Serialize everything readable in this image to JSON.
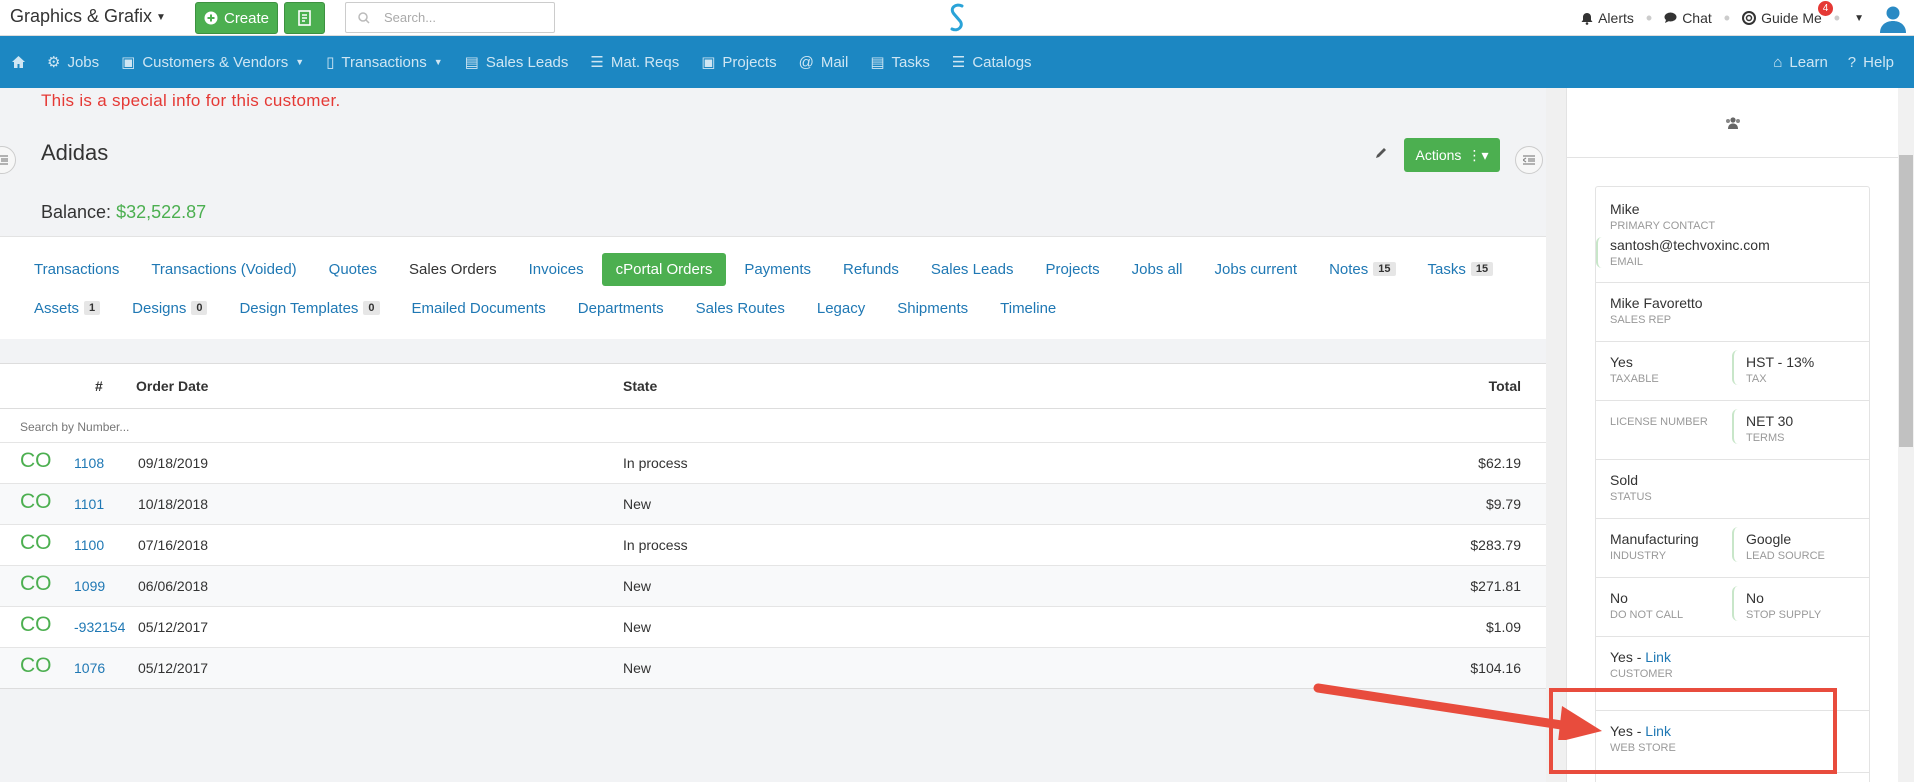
{
  "topbar": {
    "brand": "Graphics & Grafix",
    "create_label": "Create",
    "search_placeholder": "Search...",
    "alerts": "Alerts",
    "chat": "Chat",
    "guide": "Guide Me",
    "guide_badge": "4"
  },
  "nav": {
    "items": [
      "Jobs",
      "Customers & Vendors",
      "Transactions",
      "Sales Leads",
      "Mat. Reqs",
      "Projects",
      "Mail",
      "Tasks",
      "Catalogs"
    ],
    "learn": "Learn",
    "help": "Help"
  },
  "customer": {
    "special_info": "This is a special info for this customer.",
    "name": "Adidas",
    "balance_label": "Balance:",
    "balance_value": "$32,522.87",
    "actions_label": "Actions"
  },
  "tabs": {
    "row1": [
      {
        "label": "Transactions"
      },
      {
        "label": "Transactions (Voided)"
      },
      {
        "label": "Quotes"
      },
      {
        "label": "Sales Orders"
      },
      {
        "label": "Invoices"
      },
      {
        "label": "cPortal Orders"
      },
      {
        "label": "Payments"
      },
      {
        "label": "Refunds"
      },
      {
        "label": "Sales Leads"
      },
      {
        "label": "Projects"
      },
      {
        "label": "Jobs all"
      },
      {
        "label": "Jobs current"
      },
      {
        "label": "Notes",
        "count": "15"
      },
      {
        "label": "Tasks",
        "count": "15"
      }
    ],
    "row2": [
      {
        "label": "Assets",
        "count": "1"
      },
      {
        "label": "Designs",
        "count": "0"
      },
      {
        "label": "Design Templates",
        "count": "0"
      },
      {
        "label": "Emailed Documents"
      },
      {
        "label": "Departments"
      },
      {
        "label": "Sales Routes"
      },
      {
        "label": "Legacy"
      },
      {
        "label": "Shipments"
      },
      {
        "label": "Timeline"
      }
    ]
  },
  "orders": {
    "headers": {
      "num": "#",
      "date": "Order Date",
      "state": "State",
      "total": "Total"
    },
    "search_placeholder": "Search by Number...",
    "rows": [
      {
        "badge": "CO",
        "num": "1108",
        "date": "09/18/2019",
        "state": "In process",
        "total": "$62.19"
      },
      {
        "badge": "CO",
        "num": "1101",
        "date": "10/18/2018",
        "state": "New",
        "total": "$9.79"
      },
      {
        "badge": "CO",
        "num": "1100",
        "date": "07/16/2018",
        "state": "In process",
        "total": "$283.79"
      },
      {
        "badge": "CO",
        "num": "1099",
        "date": "06/06/2018",
        "state": "New",
        "total": "$271.81"
      },
      {
        "badge": "CO",
        "num": "-932154",
        "date": "05/12/2017",
        "state": "New",
        "total": "$1.09"
      },
      {
        "badge": "CO",
        "num": "1076",
        "date": "05/12/2017",
        "state": "New",
        "total": "$104.16"
      }
    ]
  },
  "panel": {
    "contact_name": "Mike",
    "contact_label": "PRIMARY CONTACT",
    "email": "santosh@techvoxinc.com",
    "email_label": "EMAIL",
    "rep": "Mike Favoretto",
    "rep_label": "SALES REP",
    "taxable": "Yes",
    "taxable_label": "TAXABLE",
    "tax": "HST - 13%",
    "tax_label": "TAX",
    "license_label": "LICENSE NUMBER",
    "terms": "NET 30",
    "terms_label": "TERMS",
    "status": "Sold",
    "status_label": "STATUS",
    "industry": "Manufacturing",
    "industry_label": "INDUSTRY",
    "lead_source": "Google",
    "lead_source_label": "LEAD SOURCE",
    "dnc": "No",
    "dnc_label": "DO NOT CALL",
    "stop_supply": "No",
    "stop_supply_label": "STOP SUPPLY",
    "customer_yes": "Yes -",
    "customer_link": "Link",
    "customer_label": "CUSTOMER",
    "webstore_yes": "Yes -",
    "webstore_link": "Link",
    "webstore_label": "WEB STORE"
  }
}
